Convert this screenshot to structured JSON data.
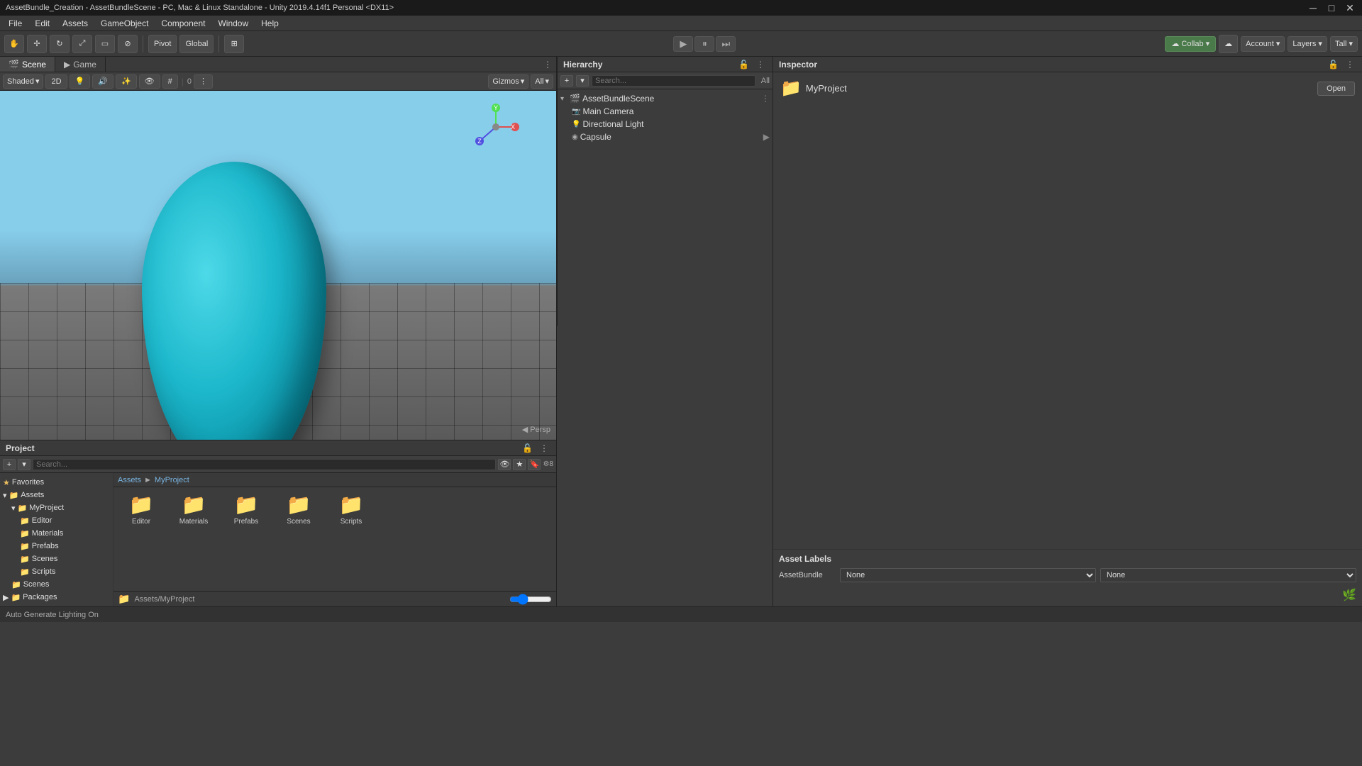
{
  "titleBar": {
    "text": "AssetBundle_Creation - AssetBundleScene - PC, Mac & Linux Standalone - Unity 2019.4.14f1 Personal <DX11>",
    "minBtn": "─",
    "maxBtn": "□",
    "closeBtn": "✕"
  },
  "menuBar": {
    "items": [
      "File",
      "Edit",
      "Assets",
      "GameObject",
      "Component",
      "Window",
      "Help"
    ]
  },
  "toolbar": {
    "tools": [
      "⊕",
      "✢",
      "↻",
      "⤢",
      "⊡",
      "⊘"
    ],
    "pivot": "Pivot",
    "global": "Global",
    "playBtn": "▶",
    "pauseBtn": "⏸",
    "stepBtn": "⏭",
    "collab": "Collab",
    "collabIcon": "☁",
    "cloudIcon": "☁",
    "account": "Account",
    "layers": "Layers",
    "layout": "Tall"
  },
  "sceneView": {
    "tabScene": "Scene",
    "tabGame": "Game",
    "shadingMode": "Shaded",
    "twoDMode": "2D",
    "gizmos": "Gizmos",
    "allLabel": "All",
    "perspLabel": "◀ Persp"
  },
  "hierarchy": {
    "title": "Hierarchy",
    "allLabel": "All",
    "scene": "AssetBundleScene",
    "items": [
      {
        "name": "Main Camera",
        "icon": "📷",
        "indent": 1
      },
      {
        "name": "Directional Light",
        "icon": "💡",
        "indent": 1
      },
      {
        "name": "Capsule",
        "icon": "◉",
        "indent": 1
      }
    ]
  },
  "inspector": {
    "title": "Inspector",
    "folderName": "MyProject",
    "openBtn": "Open",
    "assetLabels": {
      "title": "Asset Labels",
      "assetBundle": "AssetBundle",
      "noneOption1": "None",
      "noneOption2": "None"
    }
  },
  "project": {
    "title": "Project",
    "breadcrumb": {
      "assets": "Assets",
      "separator": "►",
      "myproject": "MyProject"
    },
    "tree": {
      "favorites": "Favorites",
      "assets": "Assets",
      "myProject": "MyProject",
      "editor": "Editor",
      "materials": "Materials",
      "prefabs": "Prefabs",
      "scenes": "Scenes",
      "scripts": "Scripts",
      "scenesTop": "Scenes",
      "packages": "Packages"
    },
    "files": [
      {
        "name": "Editor",
        "icon": "📁"
      },
      {
        "name": "Materials",
        "icon": "📁"
      },
      {
        "name": "Prefabs",
        "icon": "📁"
      },
      {
        "name": "Scenes",
        "icon": "📁"
      },
      {
        "name": "Scripts",
        "icon": "📁"
      }
    ],
    "footerPath": "Assets/MyProject"
  },
  "statusBar": {
    "text": "Auto Generate Lighting On"
  }
}
